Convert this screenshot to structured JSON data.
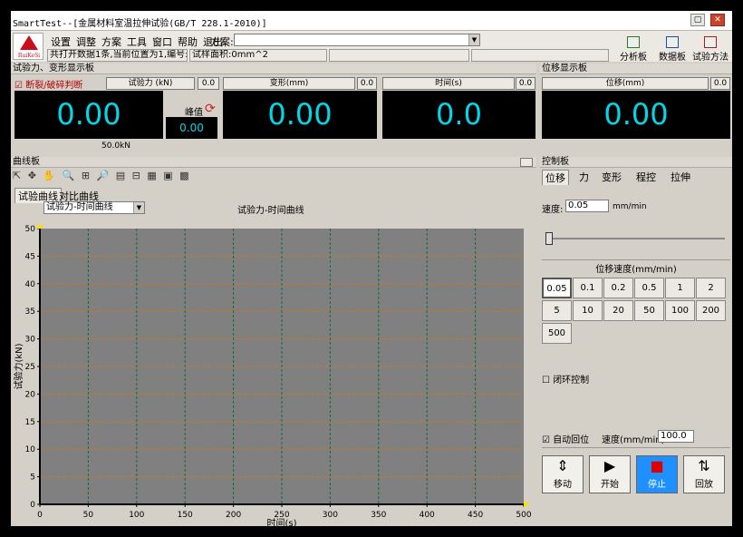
{
  "window": {
    "title": "SmartTest--[金属材料室温拉伸试验(GB/T 228.1-2010)]"
  },
  "logo_text": "RuiKeSi",
  "menu": [
    "设置",
    "调整",
    "方案",
    "工具",
    "窗口",
    "帮助",
    "退出"
  ],
  "scheme_label": "方案:",
  "scheme_value": "",
  "status": {
    "line1": "共打开数据1条,当前位置为1,编号:/",
    "line2": "试样面积:0mm^2"
  },
  "toolbar": {
    "analysis": "分析板",
    "data": "数据板",
    "method": "试验方法"
  },
  "force_section": {
    "header": "试验力、变形显示板",
    "break_check": "断裂/破碎判断",
    "force_label": "试验力 (kN)",
    "force_value": "0.00",
    "force_sub": "0.0",
    "peak_label": "峰值",
    "peak_value": "0.00",
    "range": "50.0kN",
    "deform_label": "变形(mm)",
    "deform_value": "0.00",
    "deform_sub": "0.0",
    "time_label": "时间(s)",
    "time_value": "0.0",
    "time_sub": "0.0"
  },
  "disp_section": {
    "header": "位移显示板",
    "label": "位移(mm)",
    "value": "0.00",
    "sub": "0.0"
  },
  "curve_section": {
    "header": "曲线板",
    "tabs": [
      "试验曲线",
      "对比曲线"
    ],
    "curve_select": "试验力-时间曲线",
    "chart_title": "试验力-时间曲线"
  },
  "chart_data": {
    "type": "line",
    "xlabel": "时间(s)",
    "ylabel": "试验力(kN)",
    "xlim": [
      0,
      500
    ],
    "ylim": [
      0,
      50
    ],
    "xticks": [
      "0",
      "50",
      "100",
      "150",
      "200",
      "250",
      "300",
      "350",
      "400",
      "450",
      "500"
    ],
    "yticks": [
      "0",
      "5",
      "10",
      "15",
      "20",
      "25",
      "30",
      "35",
      "40",
      "45",
      "50"
    ],
    "series": [
      {
        "values": [],
        "x": []
      }
    ],
    "grid": true,
    "background": "#808080"
  },
  "control": {
    "header": "控制板",
    "tabs": [
      "位移",
      "力",
      "变形",
      "程控",
      "拉伸"
    ],
    "speed_label": "速度:",
    "speed_value": "0.05",
    "speed_unit": "mm/min",
    "speed_group": "位移速度(mm/min)",
    "speeds": [
      "0.05",
      "0.1",
      "0.2",
      "0.5",
      "1",
      "2",
      "5",
      "10",
      "20",
      "50",
      "100",
      "200",
      "500"
    ],
    "closed_loop": "闭环控制",
    "auto_return": "自动回位",
    "return_speed_label": "速度(mm/min):",
    "return_speed_value": "100.0",
    "buttons": [
      "移动",
      "开始",
      "停止",
      "回放"
    ]
  },
  "colors": {
    "lcd_text": "#00d8e8",
    "plot_bg": "#808080",
    "grid": "#c8781c",
    "stop": "#e00000"
  }
}
